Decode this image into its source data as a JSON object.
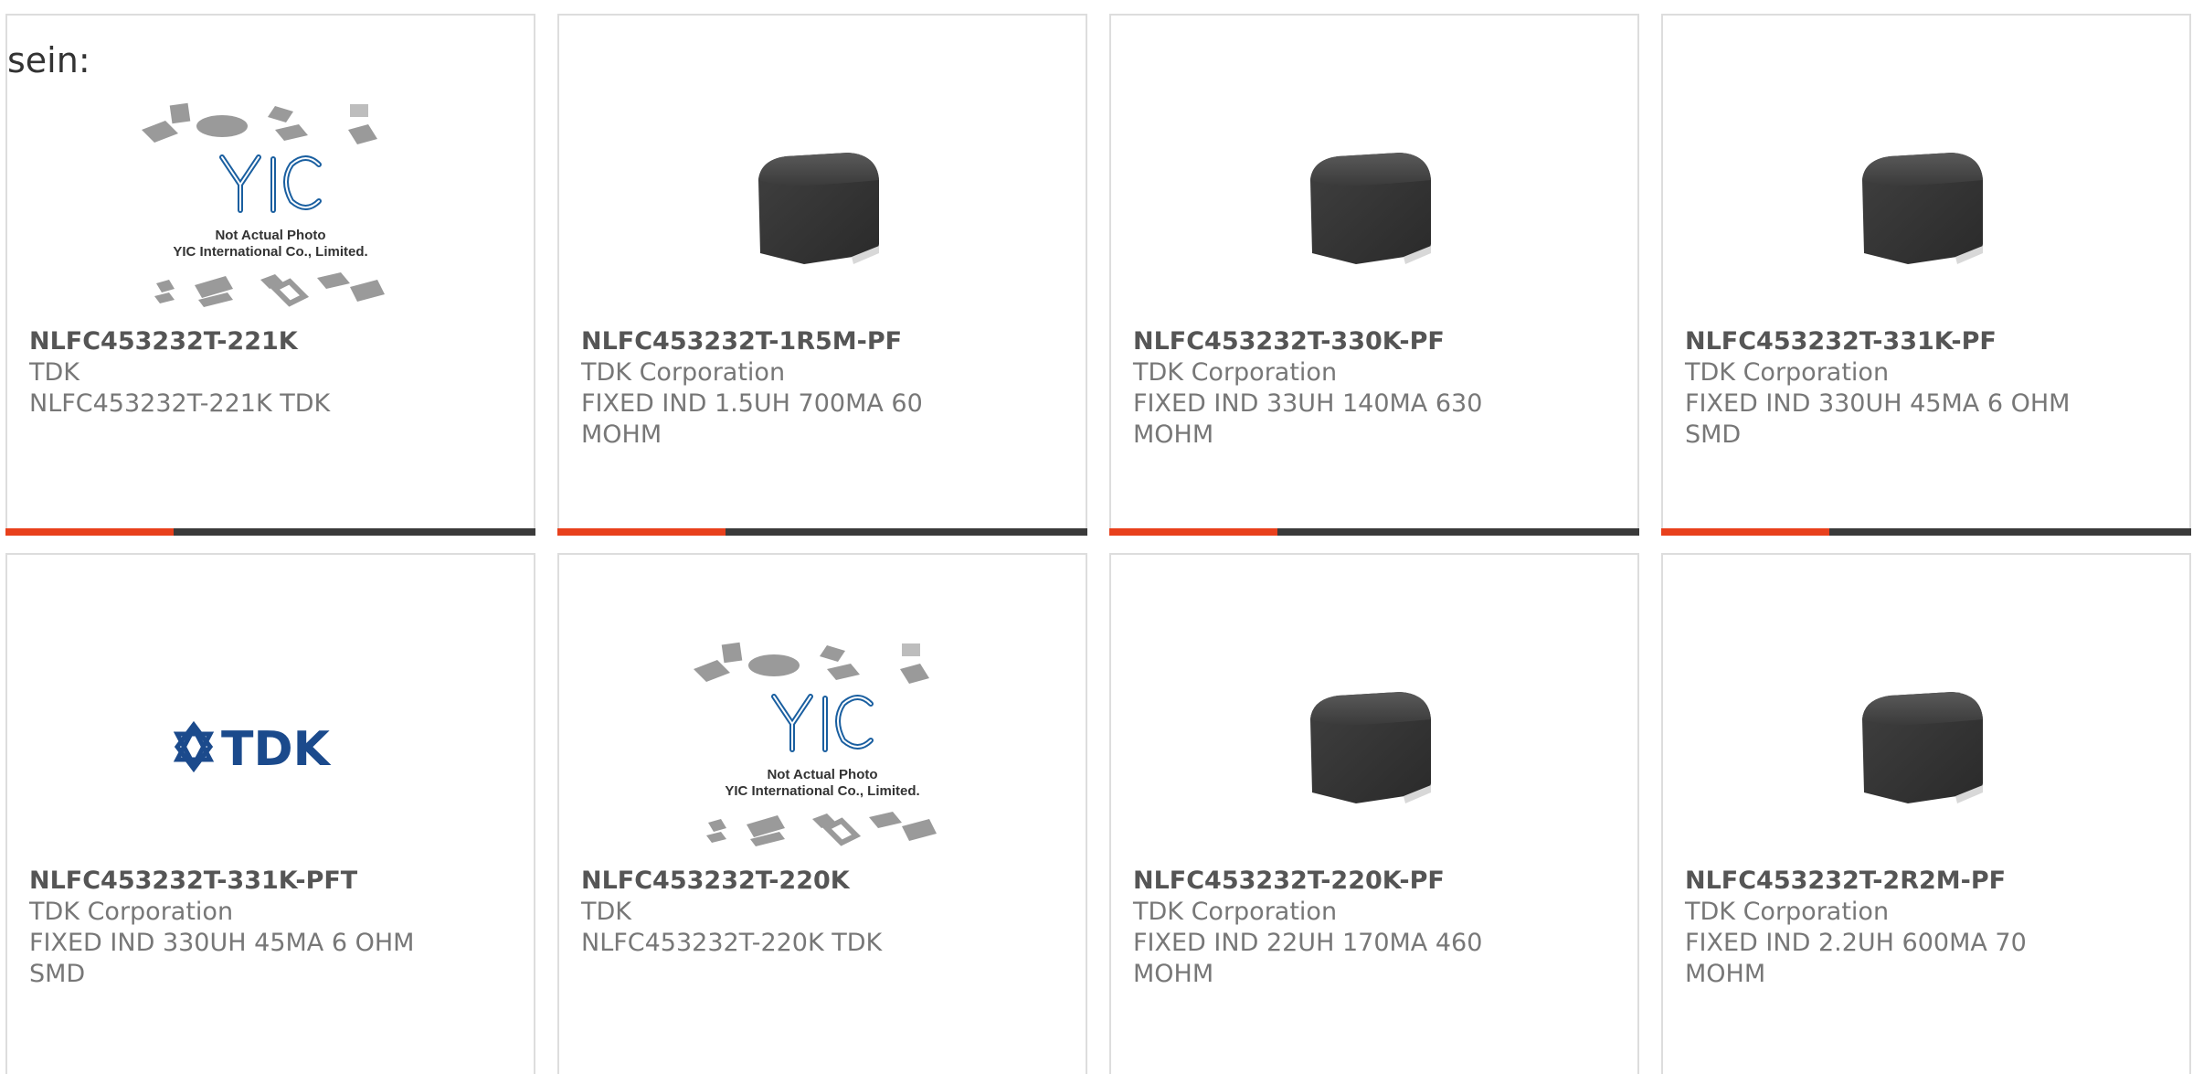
{
  "lead_text": "sein:",
  "colors": {
    "accent": "#e8401c",
    "bar": "#3a3a3a",
    "part_text": "#555555",
    "meta_text": "#777777"
  },
  "cards": [
    {
      "part": "NLFC453232T-221K",
      "manufacturer": "TDK",
      "desc_lines": [
        "NLFC453232T-221K TDK"
      ],
      "image": "yic-placeholder",
      "image_text": [
        "Not Actual Photo",
        "YIC International Co., Limited."
      ]
    },
    {
      "part": "NLFC453232T-1R5M-PF",
      "manufacturer": "TDK Corporation",
      "desc_lines": [
        "FIXED IND 1.5UH 700MA 60",
        "MOHM"
      ],
      "image": "smd-inductor"
    },
    {
      "part": "NLFC453232T-330K-PF",
      "manufacturer": "TDK Corporation",
      "desc_lines": [
        "FIXED IND 33UH 140MA 630",
        "MOHM"
      ],
      "image": "smd-inductor"
    },
    {
      "part": "NLFC453232T-331K-PF",
      "manufacturer": "TDK Corporation",
      "desc_lines": [
        "FIXED IND 330UH 45MA 6 OHM",
        "SMD"
      ],
      "image": "smd-inductor"
    },
    {
      "part": "NLFC453232T-331K-PFT",
      "manufacturer": "TDK Corporation",
      "desc_lines": [
        "FIXED IND 330UH 45MA 6 OHM",
        "SMD"
      ],
      "image": "tdk-logo"
    },
    {
      "part": "NLFC453232T-220K",
      "manufacturer": "TDK",
      "desc_lines": [
        "NLFC453232T-220K TDK"
      ],
      "image": "yic-placeholder",
      "image_text": [
        "Not Actual Photo",
        "YIC International Co., Limited."
      ]
    },
    {
      "part": "NLFC453232T-220K-PF",
      "manufacturer": "TDK Corporation",
      "desc_lines": [
        "FIXED IND 22UH 170MA 460",
        "MOHM"
      ],
      "image": "smd-inductor"
    },
    {
      "part": "NLFC453232T-2R2M-PF",
      "manufacturer": "TDK Corporation",
      "desc_lines": [
        "FIXED IND 2.2UH 600MA 70",
        "MOHM"
      ],
      "image": "smd-inductor"
    }
  ]
}
